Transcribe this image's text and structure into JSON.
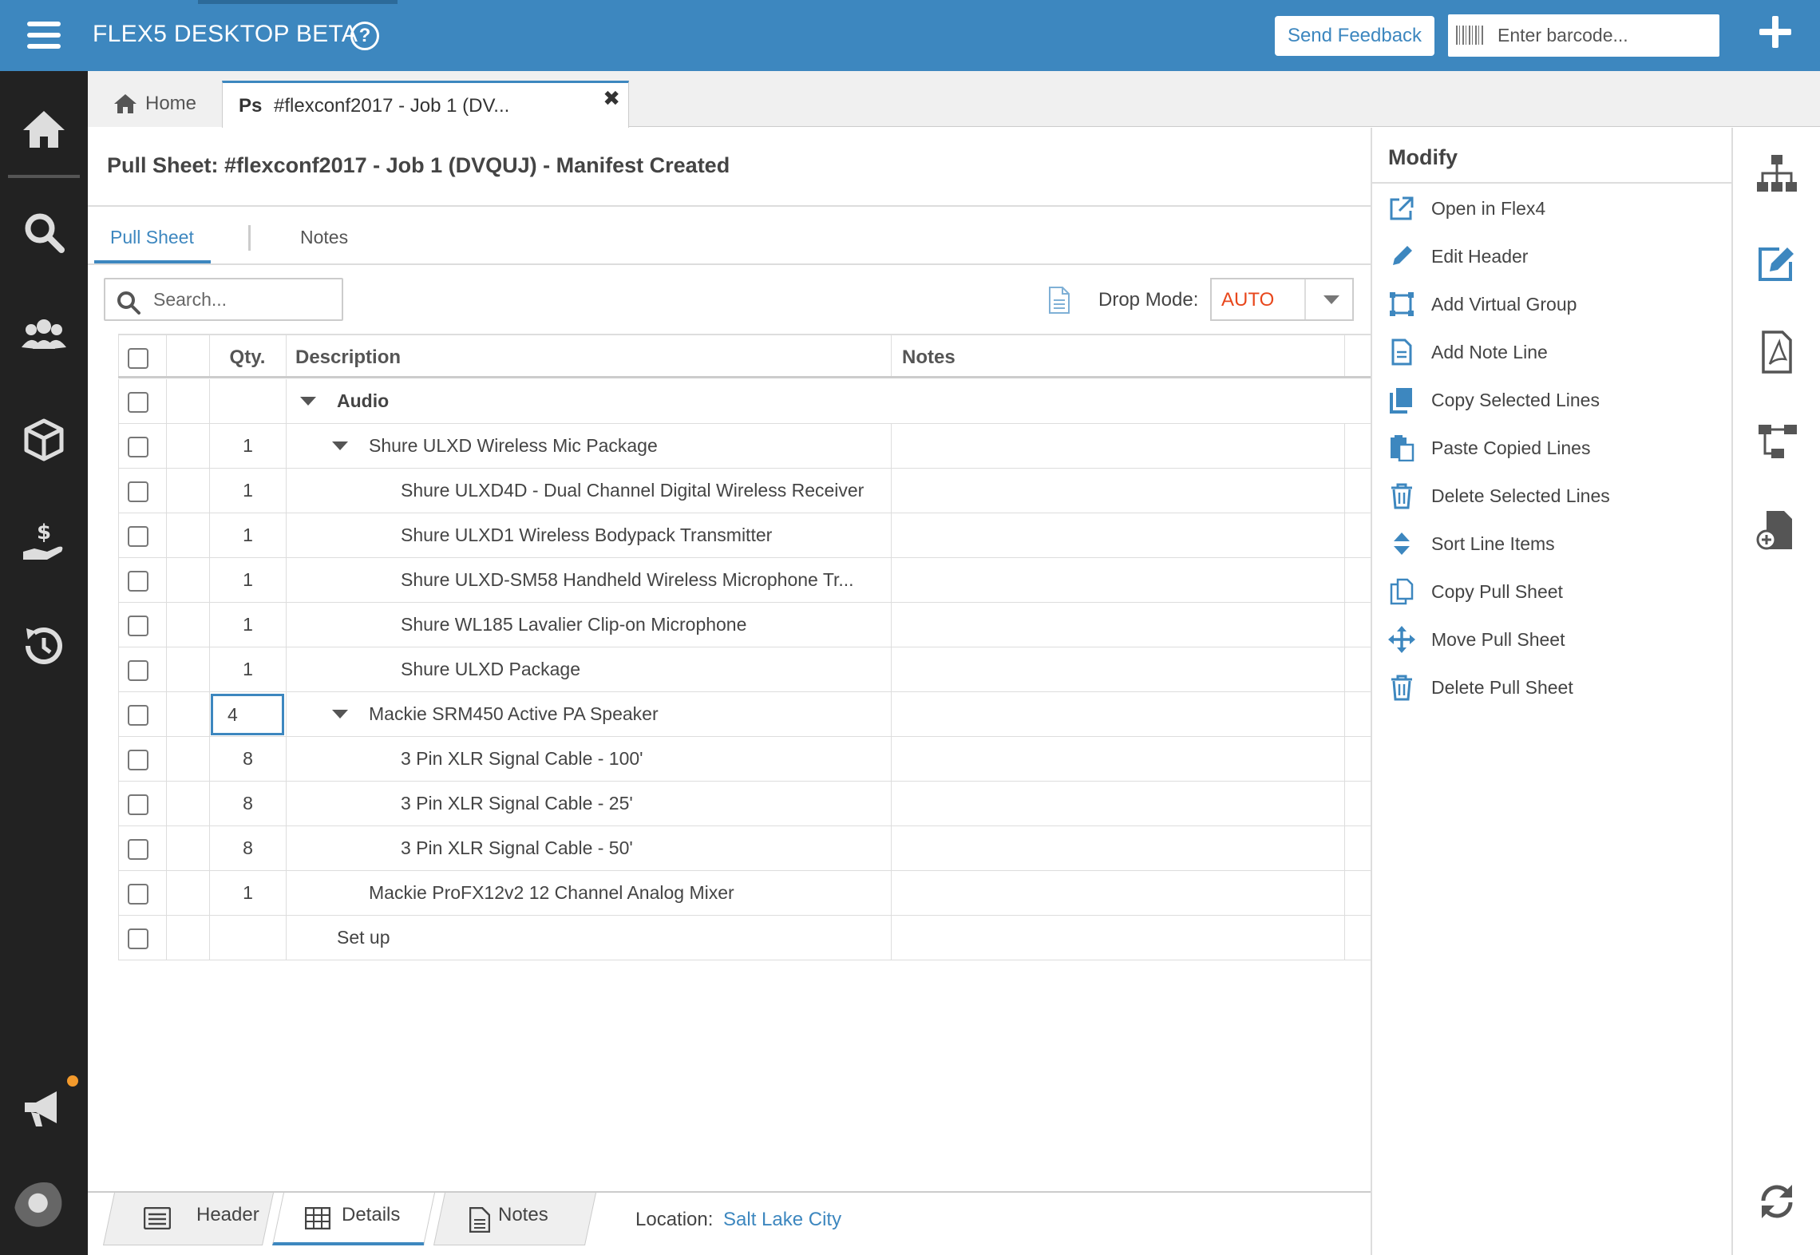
{
  "app": {
    "title": "FLEX5 DESKTOP BETA",
    "help": "?"
  },
  "header": {
    "feedback_label": "Send Feedback",
    "barcode_placeholder": "Enter barcode..."
  },
  "tabs": [
    {
      "icon": "home-icon",
      "label": "Home"
    },
    {
      "prefix": "Ps",
      "label": "#flexconf2017 - Job 1 (DV...",
      "close": "✖"
    }
  ],
  "page": {
    "title": "Pull Sheet: #flexconf2017 - Job 1 (DVQUJ) - Manifest Created"
  },
  "subtabs": [
    {
      "label": "Pull Sheet",
      "active": true
    },
    {
      "label": "Notes",
      "active": false
    }
  ],
  "toolbar": {
    "search_placeholder": "Search...",
    "drop_mode_label": "Drop Mode:",
    "drop_mode_value": "AUTO"
  },
  "grid": {
    "columns": {
      "qty": "Qty.",
      "description": "Description",
      "notes": "Notes"
    },
    "rows": [
      {
        "qty": "",
        "description": "Audio",
        "level": 0,
        "bold": true,
        "expandable": true,
        "notes": ""
      },
      {
        "qty": "1",
        "description": "Shure ULXD Wireless Mic Package",
        "level": 1,
        "bold": false,
        "expandable": true,
        "notes": ""
      },
      {
        "qty": "1",
        "description": "Shure ULXD4D - Dual Channel Digital Wireless Receiver",
        "level": 2,
        "bold": false,
        "expandable": false,
        "notes": ""
      },
      {
        "qty": "1",
        "description": "Shure ULXD1 Wireless Bodypack Transmitter",
        "level": 2,
        "bold": false,
        "expandable": false,
        "notes": ""
      },
      {
        "qty": "1",
        "description": "Shure ULXD-SM58 Handheld Wireless Microphone Tr...",
        "level": 2,
        "bold": false,
        "expandable": false,
        "notes": ""
      },
      {
        "qty": "1",
        "description": "Shure WL185 Lavalier Clip-on Microphone",
        "level": 2,
        "bold": false,
        "expandable": false,
        "notes": ""
      },
      {
        "qty": "1",
        "description": "Shure ULXD Package",
        "level": 2,
        "bold": false,
        "expandable": false,
        "notes": ""
      },
      {
        "qty": "4",
        "description": "Mackie SRM450 Active PA Speaker",
        "level": 1,
        "bold": false,
        "expandable": true,
        "editing": true,
        "notes": ""
      },
      {
        "qty": "8",
        "description": "3 Pin XLR Signal Cable - 100'",
        "level": 2,
        "bold": false,
        "expandable": false,
        "notes": ""
      },
      {
        "qty": "8",
        "description": "3 Pin XLR Signal Cable - 25'",
        "level": 2,
        "bold": false,
        "expandable": false,
        "notes": ""
      },
      {
        "qty": "8",
        "description": "3 Pin XLR Signal Cable - 50'",
        "level": 2,
        "bold": false,
        "expandable": false,
        "notes": ""
      },
      {
        "qty": "1",
        "description": "Mackie ProFX12v2 12 Channel Analog Mixer",
        "level": 1,
        "bold": false,
        "expandable": false,
        "notes": ""
      },
      {
        "qty": "",
        "description": "Set up",
        "level": 0,
        "bold": false,
        "expandable": false,
        "notes": ""
      }
    ]
  },
  "bottom_tabs": [
    {
      "label": "Header",
      "icon": "header-icon"
    },
    {
      "label": "Details",
      "icon": "table-icon",
      "active": true
    },
    {
      "label": "Notes",
      "icon": "document-icon"
    }
  ],
  "location": {
    "label": "Location:",
    "value": "Salt Lake City"
  },
  "modify": {
    "title": "Modify",
    "items": [
      {
        "label": "Open in Flex4",
        "icon": "external-link-icon"
      },
      {
        "label": "Edit Header",
        "icon": "pencil-icon"
      },
      {
        "label": "Add Virtual Group",
        "icon": "group-icon"
      },
      {
        "label": "Add Note Line",
        "icon": "note-icon"
      },
      {
        "label": "Copy Selected Lines",
        "icon": "copy-icon"
      },
      {
        "label": "Paste Copied Lines",
        "icon": "paste-icon"
      },
      {
        "label": "Delete Selected Lines",
        "icon": "trash-icon"
      },
      {
        "label": "Sort Line Items",
        "icon": "sort-icon"
      },
      {
        "label": "Copy Pull Sheet",
        "icon": "copy-outline-icon"
      },
      {
        "label": "Move Pull Sheet",
        "icon": "move-icon"
      },
      {
        "label": "Delete Pull Sheet",
        "icon": "trash-icon"
      }
    ]
  },
  "left_nav": [
    "home-icon",
    "search-icon",
    "users-icon",
    "box-icon",
    "hand-money-icon",
    "history-icon",
    "megaphone-icon",
    "avatar"
  ],
  "right_toolbar": [
    "sitemap-icon",
    "edit-icon",
    "pdf-icon",
    "hierarchy-icon",
    "add-document-icon",
    "refresh-icon"
  ],
  "colors": {
    "brand": "#3d87bf",
    "sidebar": "#222222",
    "drop_mode": "#e8471c",
    "notification": "#f39a2c"
  }
}
